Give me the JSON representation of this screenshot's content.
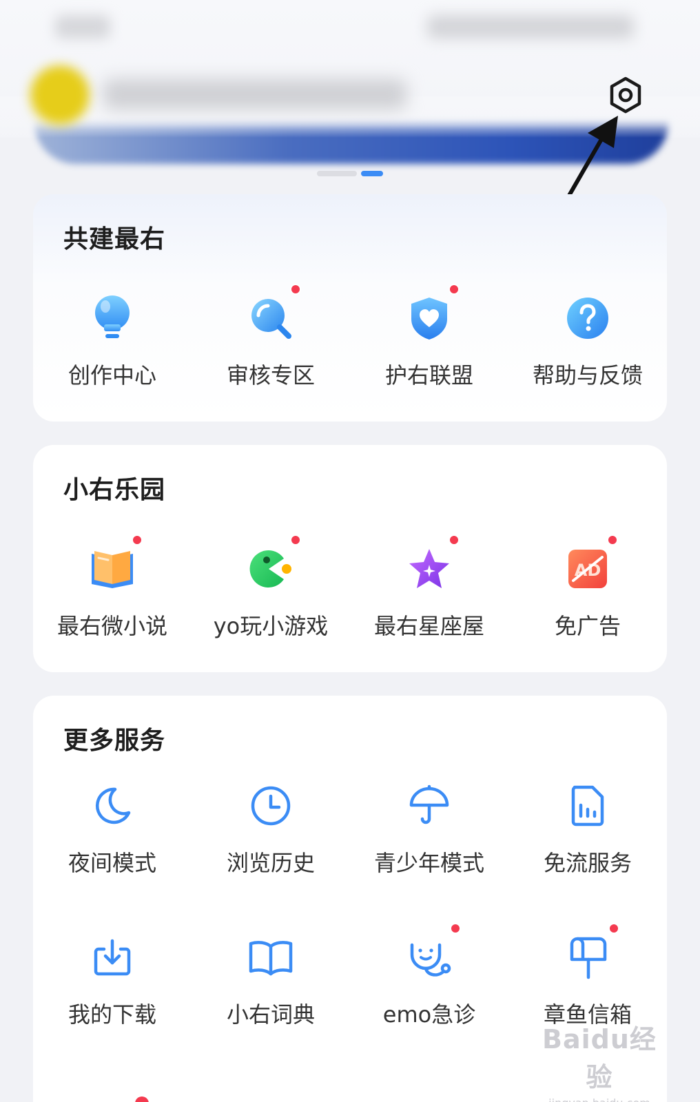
{
  "header": {
    "settings_icon": "gear-icon",
    "banner_dots": 2,
    "active_dot": 1
  },
  "sections": [
    {
      "title": "共建最右",
      "items": [
        {
          "label": "创作中心",
          "icon": "lightbulb-icon",
          "badge": false
        },
        {
          "label": "审核专区",
          "icon": "magnifier-icon",
          "badge": true
        },
        {
          "label": "护右联盟",
          "icon": "shield-heart-icon",
          "badge": true
        },
        {
          "label": "帮助与反馈",
          "icon": "question-icon",
          "badge": false
        }
      ]
    },
    {
      "title": "小右乐园",
      "items": [
        {
          "label": "最右微小说",
          "icon": "book-icon",
          "badge": true
        },
        {
          "label": "yo玩小游戏",
          "icon": "game-icon",
          "badge": true
        },
        {
          "label": "最右星座屋",
          "icon": "star-icon",
          "badge": true
        },
        {
          "label": "免广告",
          "icon": "no-ad-icon",
          "badge": true
        }
      ]
    },
    {
      "title": "更多服务",
      "items": [
        {
          "label": "夜间模式",
          "icon": "moon-icon",
          "badge": false
        },
        {
          "label": "浏览历史",
          "icon": "clock-icon",
          "badge": false
        },
        {
          "label": "青少年模式",
          "icon": "umbrella-icon",
          "badge": false
        },
        {
          "label": "免流服务",
          "icon": "data-file-icon",
          "badge": false
        },
        {
          "label": "我的下载",
          "icon": "download-icon",
          "badge": false
        },
        {
          "label": "小右词典",
          "icon": "open-book-icon",
          "badge": false
        },
        {
          "label": "emo急诊",
          "icon": "stethoscope-icon",
          "badge": true
        },
        {
          "label": "章鱼信箱",
          "icon": "mailbox-icon",
          "badge": true
        }
      ]
    }
  ],
  "watermark": {
    "main": "Baidu经验",
    "sub": "jingyan.baidu.com"
  },
  "colors": {
    "accent": "#3b8cf5",
    "badge": "#f43a4f",
    "background": "#f1f2f6"
  }
}
